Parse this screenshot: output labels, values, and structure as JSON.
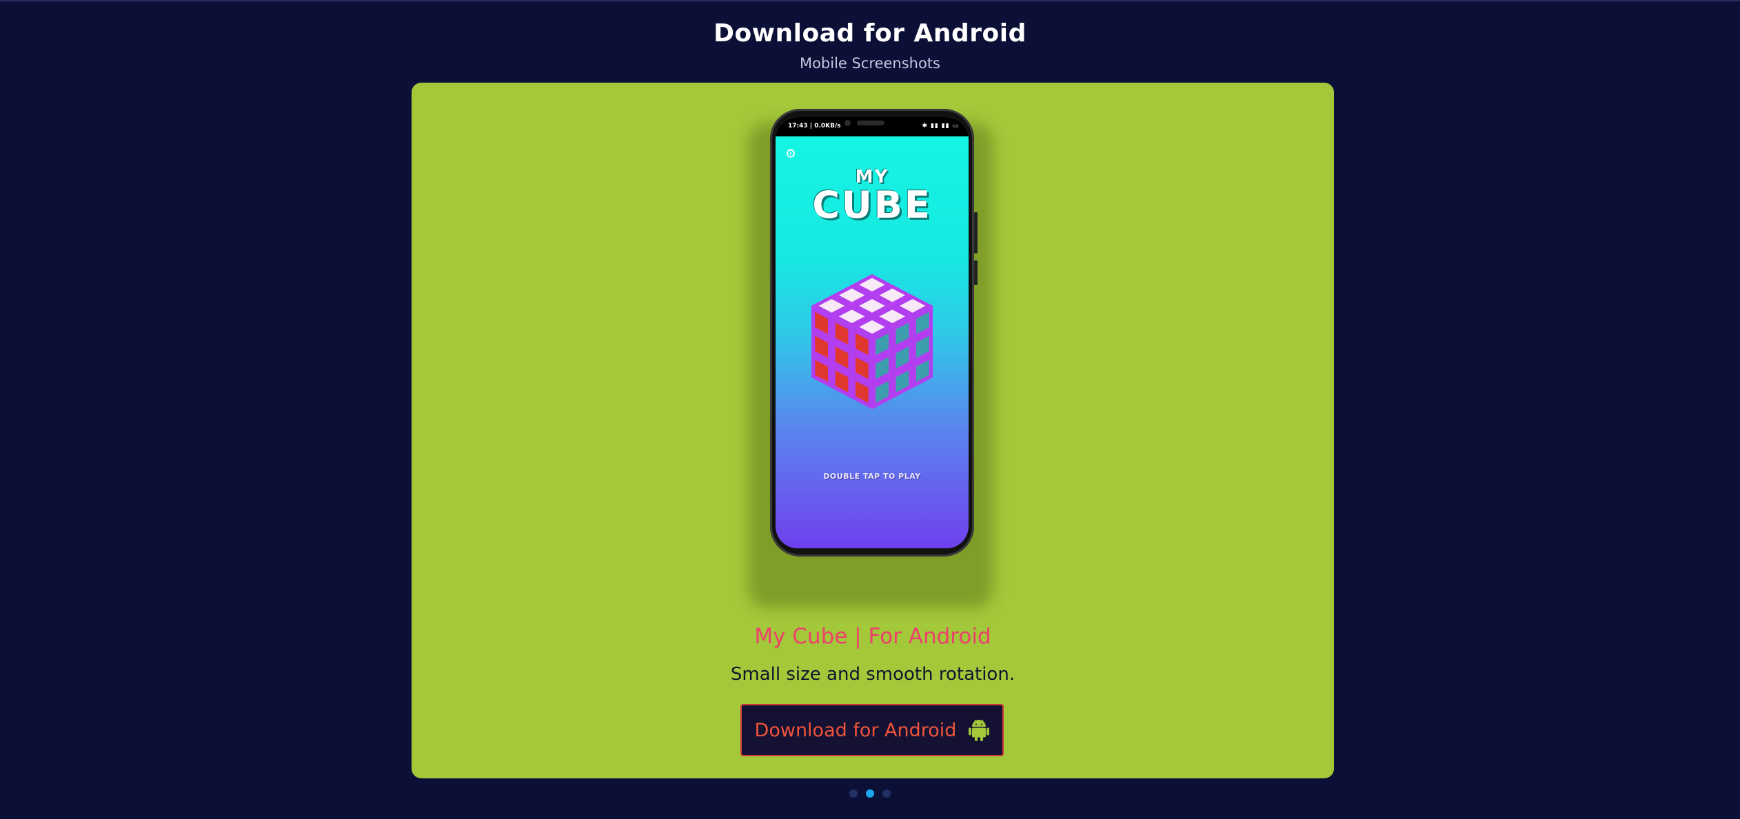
{
  "header": {
    "title": "Download for Android",
    "subtitle": "Mobile Screenshots"
  },
  "slide": {
    "phone_screen": {
      "status_time": "17:43 | 0.0KB/s",
      "status_icons": "✱ ▮▮ ▮▮ ▭",
      "game_title_small": "MY",
      "game_title_large": "CUBE",
      "prompt": "DOUBLE TAP TO PLAY",
      "settings_icon": "gear-icon"
    },
    "app_title": "My Cube | For Android",
    "description": "Small size and smooth rotation.",
    "download_button": {
      "label": "Download for Android",
      "icon": "android-icon"
    }
  },
  "carousel": {
    "slide_count": 3,
    "active_index": 1
  },
  "colors": {
    "page_background": "#0c0f36",
    "card_background": "#a3c83a",
    "app_title": "#ee3f6d",
    "button_background": "#141133",
    "button_text": "#f0543a",
    "active_dot": "#1aa7ec",
    "inactive_dot": "#223266",
    "cube_top": "#f7e9f5",
    "cube_left": "#e0382f",
    "cube_right": "#3d9fae",
    "cube_edge": "#b23ef0"
  }
}
